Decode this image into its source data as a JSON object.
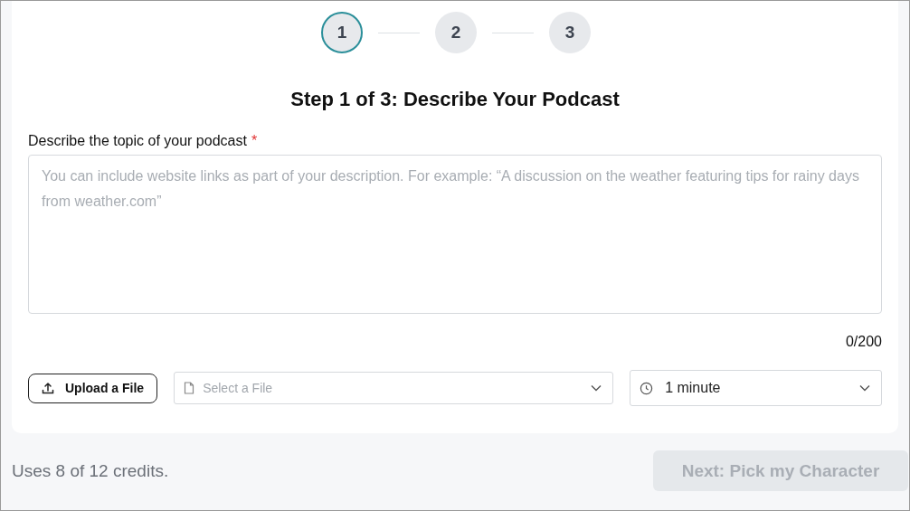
{
  "steps": [
    {
      "label": "1",
      "selected": true
    },
    {
      "label": "2",
      "selected": false
    },
    {
      "label": "3",
      "selected": false
    }
  ],
  "title": "Step 1 of 3: Describe Your Podcast",
  "topic_field": {
    "label": "Describe the topic of your podcast",
    "required": true,
    "required_mark": "*",
    "placeholder": "You can include website links as part of your description. For example: “A discussion on the weather featuring tips for rainy days from weather.com”",
    "counter": "0/200"
  },
  "upload_button": "Upload a File",
  "file_select": {
    "placeholder": "Select a File"
  },
  "duration_select": {
    "value": "1 minute"
  },
  "credits": "Uses 8 of 12 credits.",
  "next_button": {
    "label": "Next: Pick my Character",
    "disabled": true
  }
}
